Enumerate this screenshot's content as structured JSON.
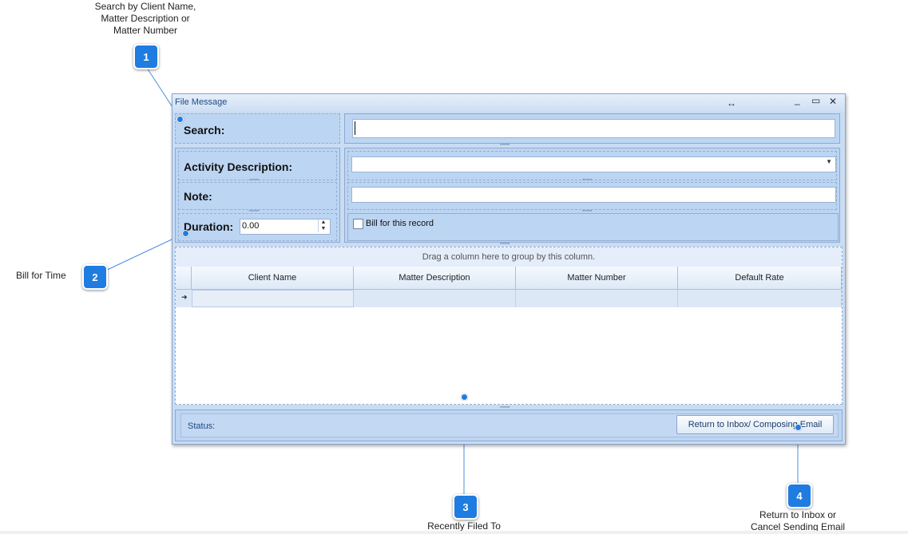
{
  "callouts": [
    {
      "number": "1",
      "text": "Search by Client Name,\nMatter Description or\nMatter Number"
    },
    {
      "number": "2",
      "text": "Bill for Time"
    },
    {
      "number": "3",
      "text": "Recently Filed To"
    },
    {
      "number": "4",
      "text": "Return to Inbox or\nCancel Sending Email"
    }
  ],
  "window": {
    "title": "File Message",
    "resize_icon": "↔",
    "min_icon": "_",
    "max_icon": "▭",
    "close_icon": "✕"
  },
  "form": {
    "search_label": "Search:",
    "search_value": "",
    "activity_label": "Activity Description:",
    "activity_value": "",
    "note_label": "Note:",
    "note_value": "",
    "duration_label": "Duration:",
    "duration_value": "0.00",
    "bill_checkbox_label": "Bill for this record",
    "bill_checked": false
  },
  "grid": {
    "group_hint": "Drag a column here to group by this column.",
    "columns": [
      "Client Name",
      "Matter Description",
      "Matter Number",
      "Default Rate"
    ],
    "rows": []
  },
  "footer": {
    "status_label": "Status:",
    "return_button": "Return to Inbox/ Composing Email"
  }
}
